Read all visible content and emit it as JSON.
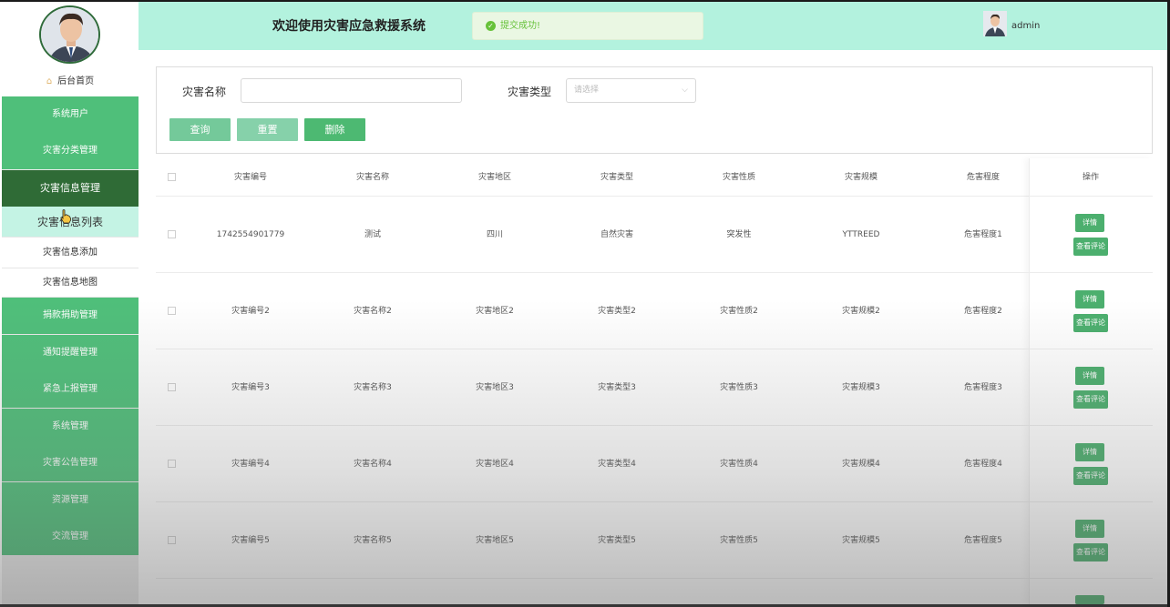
{
  "app": {
    "title": "欢迎使用灾害应急救援系统",
    "username": "admin",
    "toast": "提交成功!"
  },
  "sidebar": {
    "home_label": "后台首页",
    "items": [
      {
        "label": "系统用户"
      },
      {
        "label": "灾害分类管理"
      },
      {
        "label": "灾害信息管理"
      },
      {
        "label": "捐款捐助管理"
      },
      {
        "label": "通知提醒管理"
      },
      {
        "label": "紧急上报管理"
      },
      {
        "label": "系统管理"
      },
      {
        "label": "灾害公告管理"
      },
      {
        "label": "资源管理"
      },
      {
        "label": "交流管理"
      }
    ],
    "sub_items": [
      {
        "label": "灾害信息列表"
      },
      {
        "label": "灾害信息添加"
      },
      {
        "label": "灾害信息地图"
      }
    ]
  },
  "search": {
    "name_label": "灾害名称",
    "name_value": "",
    "type_label": "灾害类型",
    "type_placeholder": "请选择",
    "query_label": "查询",
    "reset_label": "重置",
    "delete_label": "删除"
  },
  "table": {
    "columns": [
      "灾害编号",
      "灾害名称",
      "灾害地区",
      "灾害类型",
      "灾害性质",
      "灾害规模",
      "危害程度",
      "操作"
    ],
    "detail_label": "详情",
    "comment_label": "查看评论",
    "rows": [
      [
        "1742554901779",
        "测试",
        "四川",
        "自然灾害",
        "突发性",
        "YTTREED",
        "危害程度1"
      ],
      [
        "灾害编号2",
        "灾害名称2",
        "灾害地区2",
        "灾害类型2",
        "灾害性质2",
        "灾害规模2",
        "危害程度2"
      ],
      [
        "灾害编号3",
        "灾害名称3",
        "灾害地区3",
        "灾害类型3",
        "灾害性质3",
        "灾害规模3",
        "危害程度3"
      ],
      [
        "灾害编号4",
        "灾害名称4",
        "灾害地区4",
        "灾害类型4",
        "灾害性质4",
        "灾害规模4",
        "危害程度4"
      ],
      [
        "灾害编号5",
        "灾害名称5",
        "灾害地区5",
        "灾害类型5",
        "灾害性质5",
        "灾害规模5",
        "危害程度5"
      ]
    ]
  },
  "colors": {
    "menu_green": "#4fbf7a",
    "menu_active": "#2f6b36",
    "header_bg": "#b3f2de",
    "button_green": "#4caf6e",
    "toast_green": "#67c23a"
  }
}
